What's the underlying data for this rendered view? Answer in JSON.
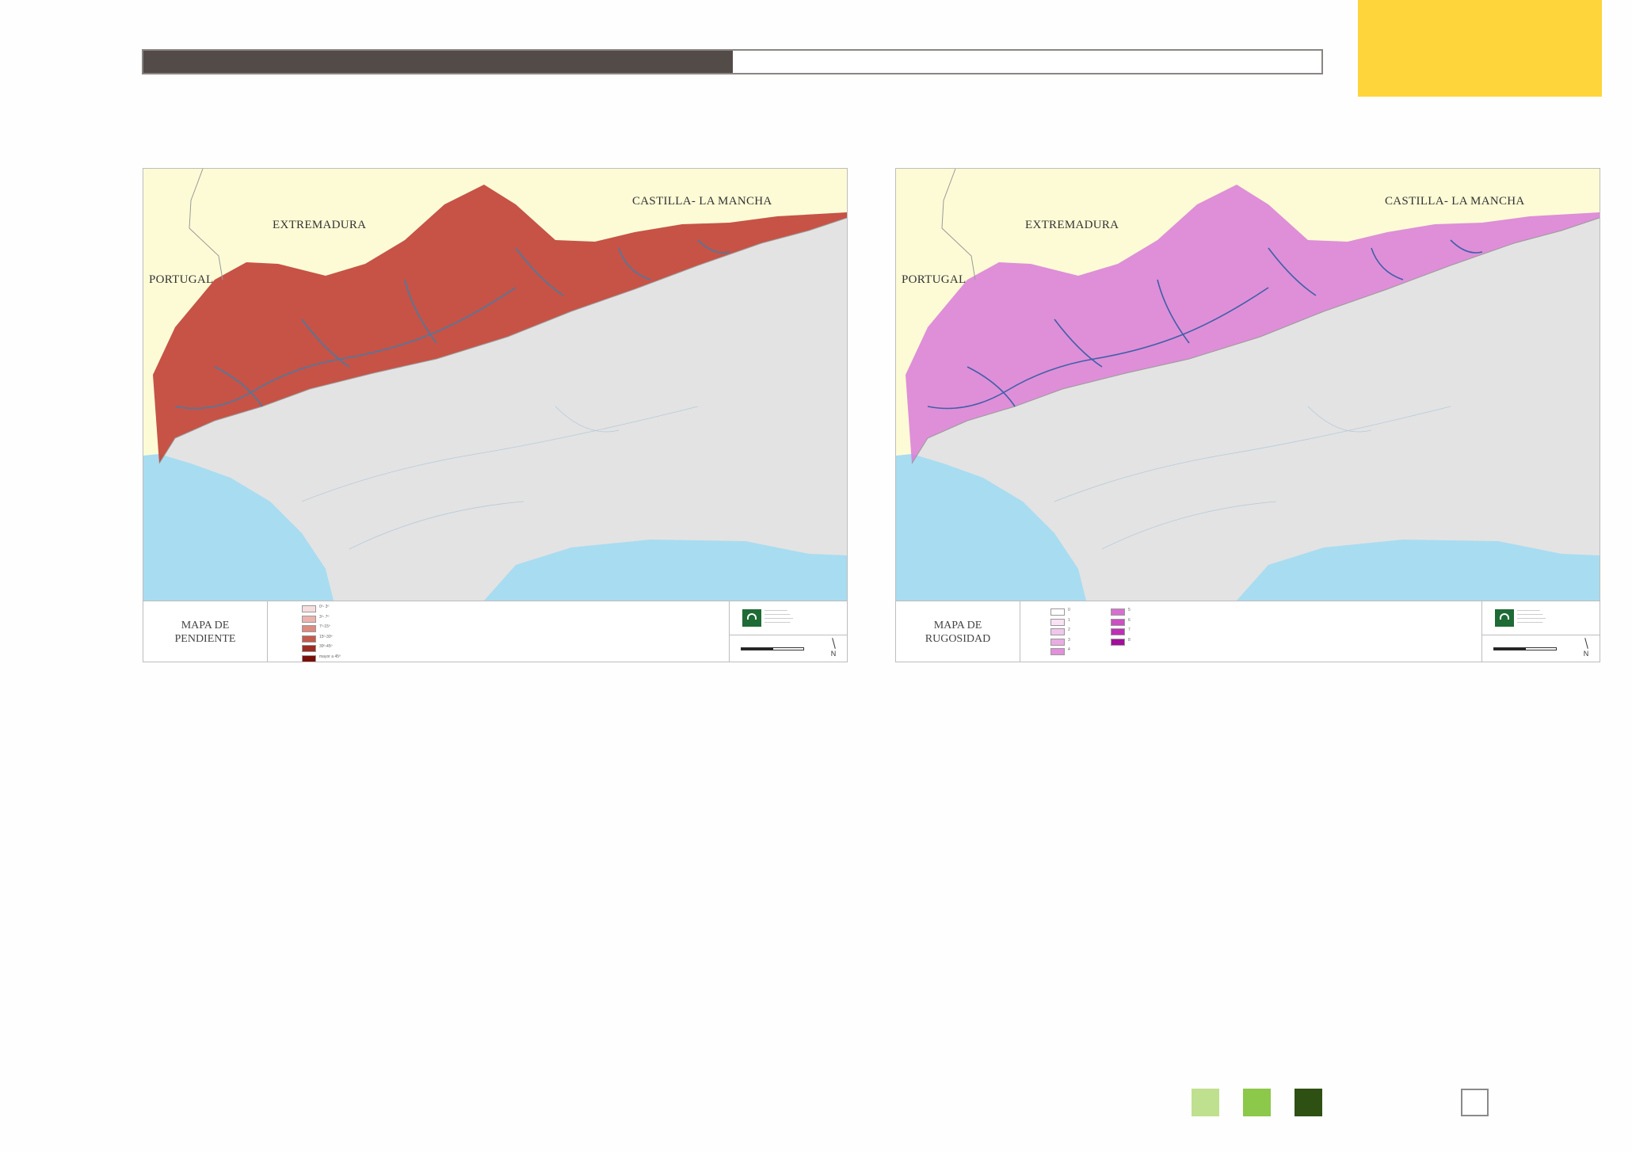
{
  "page": {
    "colors": {
      "progress_dark": "#524b48",
      "corner_tab": "#fed53b",
      "bottom_squares": [
        "#bfe08e",
        "#8cc84a",
        "#2f5013"
      ]
    },
    "progress_fraction": 0.5
  },
  "maps": [
    {
      "id": "pendiente",
      "title_line1": "MAPA DE",
      "title_line2": "PENDIENTE",
      "regions": {
        "extremadura": "EXTREMADURA",
        "castilla": "CASTILLA- LA MANCHA",
        "portugal": "PORTUGAL"
      },
      "legend": [
        {
          "label": "0º- 3º",
          "color": "#f6dede"
        },
        {
          "label": "3º- 7º",
          "color": "#ecb3ad"
        },
        {
          "label": "7º-15º",
          "color": "#dd8a80"
        },
        {
          "label": "15º-30º",
          "color": "#c35a4e"
        },
        {
          "label": "30º-45º",
          "color": "#9e2c22"
        },
        {
          "label": "mayor a 45º",
          "color": "#7a0f0a"
        }
      ],
      "shade": "#c1443a",
      "river": "#4b7aa3"
    },
    {
      "id": "rugosidad",
      "title_line1": "MAPA DE",
      "title_line2": "RUGOSIDAD",
      "regions": {
        "extremadura": "EXTREMADURA",
        "castilla": "CASTILLA- LA MANCHA",
        "portugal": "PORTUGAL"
      },
      "legend_col1": [
        {
          "label": "0",
          "color": "#ffffff"
        },
        {
          "label": "1",
          "color": "#f8e2f4"
        },
        {
          "label": "2",
          "color": "#f1c6ec"
        },
        {
          "label": "3",
          "color": "#eaabe3"
        },
        {
          "label": "4",
          "color": "#e38fdb"
        }
      ],
      "legend_col2": [
        {
          "label": "5",
          "color": "#d86fd0"
        },
        {
          "label": "6",
          "color": "#cc4fc4"
        },
        {
          "label": "7",
          "color": "#be2fb6"
        },
        {
          "label": "8",
          "color": "#a30e9b"
        }
      ],
      "shade": "#d87bd8",
      "river": "#3f5fa8"
    }
  ]
}
